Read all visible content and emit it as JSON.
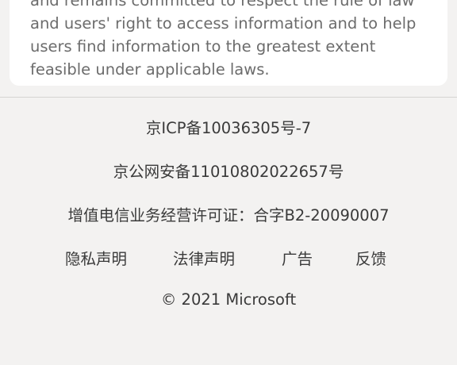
{
  "card": {
    "lines": [
      "and remains committed to respect the rule of law",
      "and users' right to access information and to help",
      "users find information to the greatest extent",
      "feasible under applicable laws."
    ]
  },
  "footer": {
    "icp": "京ICP备10036305号-7",
    "psb": "京公网安备11010802022657号",
    "license": "增值电信业务经营许可证：合字B2-20090007",
    "links": {
      "privacy": "隐私声明",
      "legal": "法律声明",
      "ads": "广告",
      "feedback": "反馈"
    },
    "copyright": "© 2021 Microsoft"
  }
}
